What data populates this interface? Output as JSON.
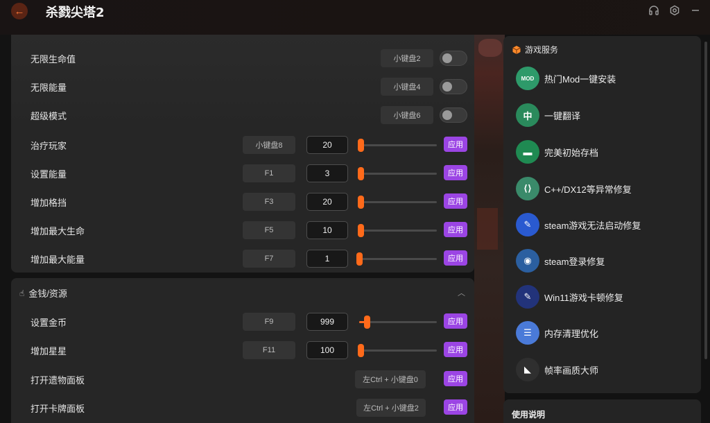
{
  "app": {
    "title": "杀戮尖塔2"
  },
  "colors": {
    "accent_orange": "#ff6a20",
    "apply_purple": "#9b45e4",
    "bg": "#121212",
    "card": "#262626"
  },
  "window_icons": [
    "headset-icon",
    "settings-icon",
    "minimize-icon"
  ],
  "toggle_rows": [
    {
      "label": "无限生命值",
      "hotkey": "小键盘2",
      "enabled": false
    },
    {
      "label": "无限能量",
      "hotkey": "小键盘4",
      "enabled": false
    },
    {
      "label": "超级模式",
      "hotkey": "小键盘6",
      "enabled": false
    }
  ],
  "value_rows": [
    {
      "label": "治疗玩家",
      "hotkey": "小键盘8",
      "value": "20",
      "slider": 0.02,
      "apply": "应用"
    },
    {
      "label": "设置能量",
      "hotkey": "F1",
      "value": "3",
      "slider": 0.02,
      "apply": "应用"
    },
    {
      "label": "增加格挡",
      "hotkey": "F3",
      "value": "20",
      "slider": 0.02,
      "apply": "应用"
    },
    {
      "label": "增加最大生命",
      "hotkey": "F5",
      "value": "10",
      "slider": 0.02,
      "apply": "应用"
    },
    {
      "label": "增加最大能量",
      "hotkey": "F7",
      "value": "1",
      "slider": 0.0,
      "apply": "应用"
    }
  ],
  "section2": {
    "title": "金钱/资源",
    "value_rows": [
      {
        "label": "设置金币",
        "hotkey": "F9",
        "value": "999",
        "slider": 0.1,
        "apply": "应用"
      },
      {
        "label": "增加星星",
        "hotkey": "F11",
        "value": "100",
        "slider": 0.02,
        "apply": "应用"
      }
    ],
    "action_rows": [
      {
        "label": "打开遗物面板",
        "hotkey": "左Ctrl + 小键盘0",
        "apply": "应用"
      },
      {
        "label": "打开卡牌面板",
        "hotkey": "左Ctrl + 小键盘2",
        "apply": "应用"
      }
    ]
  },
  "services": {
    "title": "游戏服务",
    "items": [
      {
        "label": "热门Mod一键安装",
        "icon": "mod-icon",
        "glyph": "MOD",
        "color": "#2e9a6a"
      },
      {
        "label": "一键翻译",
        "icon": "translate-icon",
        "glyph": "中",
        "color": "#2a8a5c"
      },
      {
        "label": "完美初始存档",
        "icon": "save-folder-icon",
        "glyph": "▬",
        "color": "#1f8a52"
      },
      {
        "label": "C++/DX12等异常修复",
        "icon": "file-repair-icon",
        "glyph": "⟨⟩",
        "color": "#3a8a6a"
      },
      {
        "label": "steam游戏无法启动修复",
        "icon": "wrench-icon",
        "glyph": "✎",
        "color": "#2a5ad0"
      },
      {
        "label": "steam登录修复",
        "icon": "steam-icon",
        "glyph": "◉",
        "color": "#2b5fa0"
      },
      {
        "label": "Win11游戏卡顿修复",
        "icon": "wrench-icon",
        "glyph": "✎",
        "color": "#22337a"
      },
      {
        "label": "内存清理优化",
        "icon": "memory-clean-icon",
        "glyph": "☰",
        "color": "#4a7ad8"
      },
      {
        "label": "帧率画质大师",
        "icon": "fps-master-icon",
        "glyph": "◣",
        "color": "#2f2f2f"
      }
    ]
  },
  "usage": {
    "title": "使用说明"
  }
}
